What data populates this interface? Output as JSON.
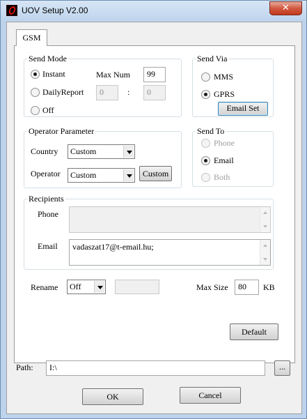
{
  "window": {
    "title": "UOV Setup V2.00",
    "close_glyph": "✕"
  },
  "tabs": [
    {
      "label": "GSM"
    }
  ],
  "send_mode": {
    "legend": "Send Mode",
    "options": [
      {
        "label": "Instant",
        "checked": true
      },
      {
        "label": "DailyReport",
        "checked": false
      },
      {
        "label": "Off",
        "checked": false
      }
    ],
    "max_num_label": "Max Num",
    "max_num_value": "99",
    "time_hour": "0",
    "time_sep": ":",
    "time_min": "0"
  },
  "send_via": {
    "legend": "Send Via",
    "options": [
      {
        "label": "MMS",
        "checked": false
      },
      {
        "label": "GPRS",
        "checked": true
      }
    ],
    "email_set_button": "Email Set"
  },
  "operator_parameter": {
    "legend": "Operator Parameter",
    "country_label": "Country",
    "country_value": "Custom",
    "operator_label": "Operator",
    "operator_value": "Custom",
    "custom_button": "Custom"
  },
  "send_to": {
    "legend": "Send To",
    "options": [
      {
        "label": "Phone",
        "checked": false,
        "enabled": false
      },
      {
        "label": "Email",
        "checked": true,
        "enabled": true
      },
      {
        "label": "Both",
        "checked": false,
        "enabled": false
      }
    ]
  },
  "recipients": {
    "legend": "Recipients",
    "phone_label": "Phone",
    "phone_value": "",
    "email_label": "Email",
    "email_value": "vadaszat17@t-email.hu;"
  },
  "rename": {
    "label": "Rename",
    "value": "Off",
    "text": ""
  },
  "max_size": {
    "label": "Max Size",
    "value": "80",
    "unit": "KB"
  },
  "default_button": "Default",
  "path": {
    "label": "Path:",
    "value": "I:\\",
    "browse_button": "..."
  },
  "footer": {
    "ok_button": "OK",
    "cancel_button": "Cancel"
  }
}
